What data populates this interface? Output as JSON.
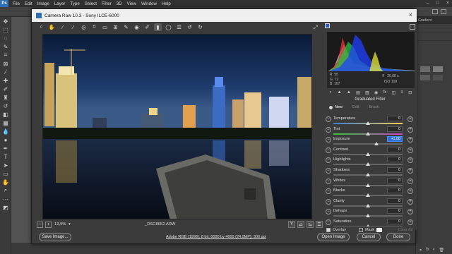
{
  "ps": {
    "menus": [
      "File",
      "Edit",
      "Image",
      "Layer",
      "Type",
      "Select",
      "Filter",
      "3D",
      "View",
      "Window",
      "Help"
    ],
    "logo": "Ps",
    "right_tab": "Gradient"
  },
  "dialog": {
    "title": "Camera Raw 10.3  -  Sony ILCE-6000",
    "zoom": "13,9%",
    "filename": "_DSC8652.ARW",
    "workflow": "Adobe RGB (1998); 8 bit; 6000 by 4000 (24,0MP); 300 ppi",
    "buttons": {
      "save": "Save Image...",
      "open": "Open Image",
      "cancel": "Cancel",
      "done": "Done"
    }
  },
  "panel": {
    "readout": {
      "r": "R:",
      "r_val": "55",
      "g": "G:",
      "g_val": "72",
      "b": "B:",
      "b_val": "107",
      "fstop": "f/",
      "shutter": "20,00 s",
      "iso": "ISO 100"
    },
    "title": "Graduated Filter",
    "modes": {
      "new": "New",
      "edit": "Edit",
      "brush": "Brush"
    },
    "sliders": [
      {
        "label": "Temperature",
        "value": "0",
        "pos": 0.5,
        "track": "temp"
      },
      {
        "label": "Tint",
        "value": "0",
        "pos": 0.5,
        "track": "tint"
      },
      {
        "label": "Exposure",
        "value": "+1,00",
        "pos": 0.62,
        "track": "gray",
        "selected": true
      },
      {
        "label": "Contrast",
        "value": "0",
        "pos": 0.5,
        "track": "gray"
      },
      {
        "label": "Highlights",
        "value": "0",
        "pos": 0.5,
        "track": "gray"
      },
      {
        "label": "Shadows",
        "value": "0",
        "pos": 0.5,
        "track": "gray"
      },
      {
        "label": "Whites",
        "value": "0",
        "pos": 0.5,
        "track": "gray"
      },
      {
        "label": "Blacks",
        "value": "0",
        "pos": 0.5,
        "track": "gray"
      },
      {
        "label": "Clarity",
        "value": "0",
        "pos": 0.5,
        "track": "gray"
      },
      {
        "label": "Dehaze",
        "value": "0",
        "pos": 0.5,
        "track": "gray"
      },
      {
        "label": "Saturation",
        "value": "0",
        "pos": 0.5,
        "track": "gray"
      }
    ],
    "overlay": "Overlay",
    "mask": "Mask",
    "clear_all": "Clear All"
  },
  "colors": {
    "accent": "#2f6fd6",
    "panel": "#3b3b3b",
    "photo_sky": "#0d1e3a"
  }
}
